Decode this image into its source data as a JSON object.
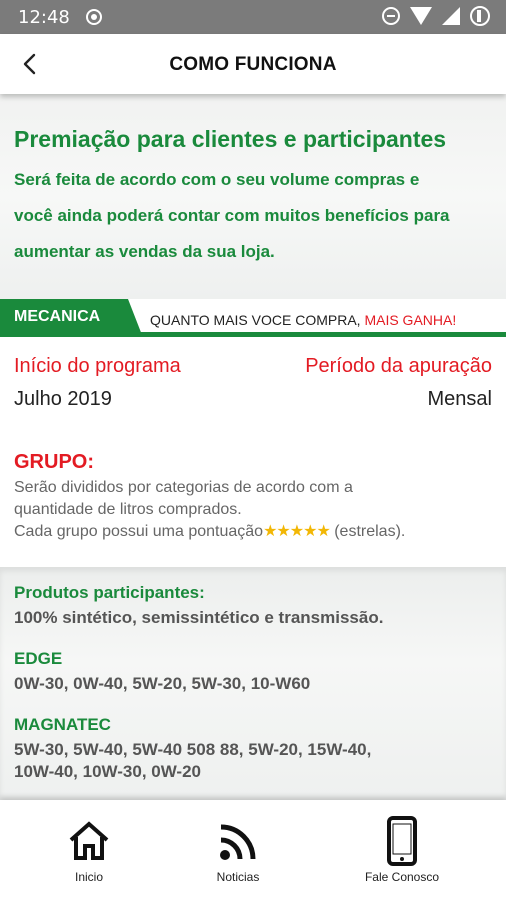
{
  "status_bar": {
    "time": "12:48"
  },
  "app_bar": {
    "title": "COMO FUNCIONA"
  },
  "intro": {
    "title": "Premiação para clientes e participantes",
    "text_lines": [
      "Será feita de acordo com o seu volume compras e",
      "você ainda poderá contar com muitos benefícios para",
      "aumentar as vendas da sua loja."
    ]
  },
  "mecanica": {
    "tag": "MECANICA",
    "slogan": "QUANTO MAIS VOCE COMPRA,",
    "slogan_highlight": "MAIS GANHA!"
  },
  "program": {
    "start_label": "Início do programa",
    "start_value": "Julho 2019",
    "period_label": "Período da apuração",
    "period_value": "Mensal"
  },
  "grupo": {
    "title": "GRUPO:",
    "line1": "Serão divididos por categorias de acordo com a",
    "line2": "quantidade de litros comprados.",
    "line3_before": "Cada grupo possui uma pontuação",
    "stars": "★★★★★",
    "line3_after": " (estrelas)."
  },
  "produtos": {
    "heading": "Produtos participantes:",
    "text": "100% sintético, semissintético e transmissão.",
    "edge_title": "EDGE",
    "edge_items": "0W-30, 0W-40, 5W-20, 5W-30, 10-W60",
    "magnatec_title": "MAGNATEC",
    "magnatec_line1": "5W-30, 5W-40, 5W-40 508 88, 5W-20, 15W-40,",
    "magnatec_line2": "10W-40, 10W-30, 0W-20"
  },
  "bottom_nav": {
    "items": [
      {
        "label": "Inicio",
        "icon": "home-icon"
      },
      {
        "label": "Noticias",
        "icon": "rss-icon"
      },
      {
        "label": "Fale Conosco",
        "icon": "smartphone-icon"
      }
    ]
  },
  "colors": {
    "brand_green": "#1a8a3c",
    "accent_red": "#e31b23",
    "star_gold": "#f2b705",
    "status_bar": "#7b7b7b"
  }
}
